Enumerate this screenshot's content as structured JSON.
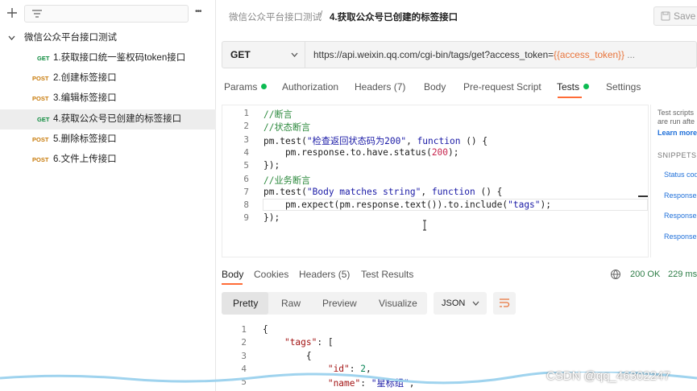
{
  "sidebar": {
    "add_icon": "plus-icon",
    "filter_icon": "filter-icon",
    "more_label": "•••",
    "collection": {
      "name": "微信公众平台接口测试"
    },
    "requests": [
      {
        "method": "GET",
        "name": "1.获取接口统一鉴权码token接口",
        "selected": false
      },
      {
        "method": "POST",
        "name": "2.创建标签接口",
        "selected": false
      },
      {
        "method": "POST",
        "name": "3.编辑标签接口",
        "selected": false
      },
      {
        "method": "GET",
        "name": "4.获取公众号已创建的标签接口",
        "selected": true
      },
      {
        "method": "POST",
        "name": "5.删除标签接口",
        "selected": false
      },
      {
        "method": "POST",
        "name": "6.文件上传接口",
        "selected": false
      }
    ]
  },
  "header": {
    "breadcrumb_parent": "微信公众平台接口测试",
    "separator": "/",
    "breadcrumb_current": "4.获取公众号已创建的标签接口",
    "save_label": "Save"
  },
  "request": {
    "method": "GET",
    "url_prefix": "https://api.weixin.qq.com/cgi-bin/tags/get?access_token=",
    "url_var": "{{access_token}}",
    "url_suffix": " ..."
  },
  "tabs": [
    {
      "label": "Params",
      "dot": true
    },
    {
      "label": "Authorization"
    },
    {
      "label": "Headers (7)"
    },
    {
      "label": "Body"
    },
    {
      "label": "Pre-request Script"
    },
    {
      "label": "Tests",
      "dot": true,
      "active": true
    },
    {
      "label": "Settings"
    }
  ],
  "editor": {
    "line_numbers": [
      "1",
      "2",
      "3",
      "4",
      "5",
      "6",
      "7",
      "8",
      "9"
    ],
    "lines": [
      "//断言",
      "//状态断言",
      "pm.test(\"检查返回状态码为200\", function () {",
      "    pm.response.to.have.status(200);",
      "});",
      "//业务断言",
      "pm.test(\"Body matches string\", function () {",
      "    pm.expect(pm.response.text()).to.include(\"tags\");",
      "});"
    ]
  },
  "snippets_panel": {
    "intro_1": "Test scripts",
    "intro_2": "are run afte",
    "learn_more": "Learn more",
    "heading": "SNIPPETS",
    "items": [
      "Status code",
      "Response b",
      "Response b",
      "Response b"
    ]
  },
  "response": {
    "tabs": [
      "Body",
      "Cookies",
      "Headers (5)",
      "Test Results"
    ],
    "status": "200 OK",
    "time": "229 ms",
    "globe_icon": "globe-icon",
    "formats": [
      "Pretty",
      "Raw",
      "Preview",
      "Visualize"
    ],
    "language": "JSON",
    "wrap_icon": "wrap-lines-icon",
    "line_numbers": [
      "1",
      "2",
      "3",
      "4",
      "5"
    ],
    "lines": [
      "{",
      "    \"tags\": [",
      "        {",
      "            \"id\": 2,",
      "            \"name\": \"星标组\","
    ]
  },
  "watermark": "CSDN @qq_46302247"
}
